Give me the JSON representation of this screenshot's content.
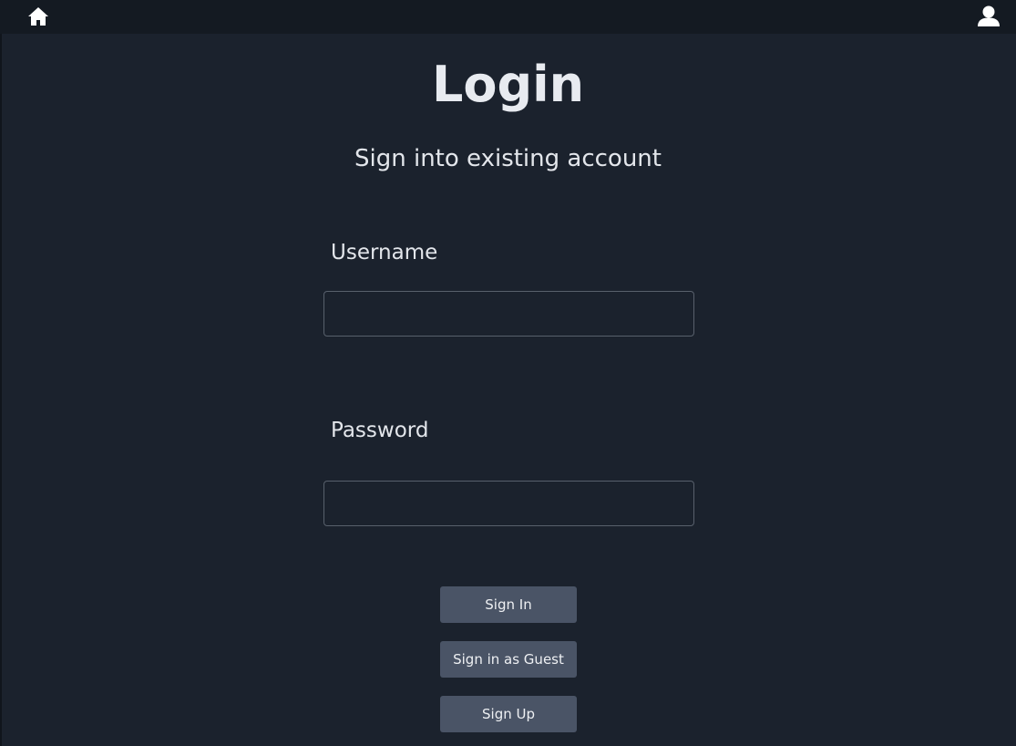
{
  "topbar": {
    "home_icon": "home-icon",
    "user_icon": "user-icon"
  },
  "page": {
    "title": "Login",
    "subtitle": "Sign into existing account"
  },
  "form": {
    "username_label": "Username",
    "username_value": "",
    "password_label": "Password",
    "password_value": ""
  },
  "buttons": {
    "sign_in": "Sign In",
    "guest": "Sign in as Guest",
    "sign_up": "Sign Up"
  },
  "colors": {
    "background": "#1b222d",
    "topbar": "#141a22",
    "button": "#4a5466",
    "text": "#e6e9ee"
  }
}
